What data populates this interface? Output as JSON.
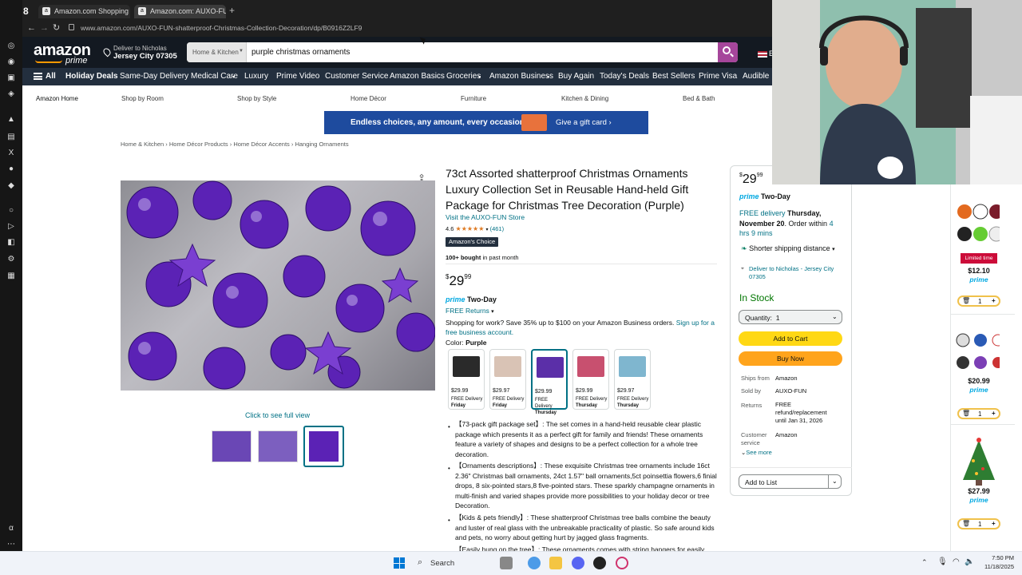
{
  "browser": {
    "tabs": [
      {
        "label": "Amazon.com Shopping C",
        "active": false
      },
      {
        "label": "Amazon.com: AUXO-FUN",
        "active": true
      }
    ],
    "new_tab": "+",
    "url": "www.amazon.com/AUXO-FUN-shatterproof-Christmas-Collection-Decoration/dp/B0916Z2LF9",
    "badge": "8"
  },
  "header": {
    "logo": "amazon",
    "logo_sub": "prime",
    "deliver_line1": "Deliver to Nicholas",
    "deliver_line2": "Jersey City 07305",
    "search_scope": "Home & Kitchen",
    "search_value": "purple christmas ornaments",
    "flag": "E"
  },
  "nav": {
    "all": "All",
    "items": [
      "Holiday Deals",
      "Same-Day Delivery",
      "Medical Care",
      "Luxury",
      "Prime Video",
      "Customer Service",
      "Amazon Basics",
      "Groceries",
      "Amazon Business",
      "Buy Again",
      "Today's Deals",
      "Best Sellers",
      "Prime Visa",
      "Audible"
    ]
  },
  "categories": [
    "Amazon Home",
    "Shop by Room",
    "Shop by Style",
    "Home Décor",
    "Furniture",
    "Kitchen & Dining",
    "Bed & Bath"
  ],
  "banner": {
    "text": "Endless choices, any amount, every occasion",
    "cta": "Give a gift card ›"
  },
  "breadcrumb": [
    "Home & Kitchen",
    "Home Décor Products",
    "Home Décor Accents",
    "Hanging Ornaments"
  ],
  "product": {
    "title": "73ct Assorted shatterproof Christmas Ornaments Luxury Collection Set in Reusable Hand-held Gift Package for Christmas Tree Decoration (Purple)",
    "store": "Visit the AUXO-FUN Store",
    "rating": "4.6",
    "stars": "★★★★★",
    "reviews": "(461)",
    "choice": "Amazon's Choice",
    "bought_bold": "100+ bought",
    "bought_rest": " in past month",
    "price_symbol": "$",
    "price_whole": "29",
    "price_frac": "99",
    "prime": "prime",
    "prime_two_day": "Two-Day",
    "free_returns": "FREE Returns",
    "business_text": "Shopping for work? Save 35% up to $100 on your Amazon Business orders.",
    "business_link": "Sign up for a free business account.",
    "color_label": "Color:",
    "color_value": "Purple",
    "click_full_view": "Click to see full view",
    "swatches": [
      {
        "price": "$29.99",
        "delivery": "FREE Delivery",
        "day": "Friday",
        "color": "#2a2a2a"
      },
      {
        "price": "$29.97",
        "delivery": "FREE Delivery",
        "day": "Friday",
        "color": "#d9c3b5"
      },
      {
        "price": "$29.99",
        "delivery": "FREE Delivery",
        "day": "Thursday",
        "color": "#5b2fa8"
      },
      {
        "price": "$29.99",
        "delivery": "FREE Delivery",
        "day": "Thursday",
        "color": "#c8506f"
      },
      {
        "price": "$29.97",
        "delivery": "FREE Delivery",
        "day": "Thursday",
        "color": "#7fb6cf"
      }
    ],
    "bullets": [
      "【73-pack gift package set】: The set comes in a hand-held reusable clear plastic package which presents it as a perfect gift for family and friends! These ornaments feature a variety of shapes and designs to be a perfect collection for a whole tree decoration.",
      "【Ornaments descriptions】: These exquisite Christmas tree ornaments include 16ct 2.36\" Christmas ball ornaments, 24ct 1.57\" ball ornaments,5ct poinsettia flowers,6 finial drops, 8 six-pointed stars,8 five-pointed stars. These sparkly champagne ornaments in multi-finish and varied shapes provide more possibilities to your holiday decor or tree Decoration.",
      "【Kids & pets friendly】: These shatterproof Christmas tree balls combine the beauty and luster of real glass with the unbreakable practicality of plastic. So safe around kids and pets, no worry about getting hurt by jagged glass fragments.",
      "【Easily hung on the tree】: These ornaments comes with string hangers for easily"
    ]
  },
  "buybox": {
    "price_symbol": "$",
    "price_whole": "29",
    "price_frac": "99",
    "prime": "prime",
    "two_day": "Two-Day",
    "free_delivery": "FREE delivery",
    "delivery_date": "Thursday, November 20",
    "order_within": ". Order within",
    "order_time": "4 hrs 9 mins",
    "shorter_shipping": "Shorter shipping distance",
    "deliver_to": "Deliver to Nicholas - Jersey City 07305",
    "in_stock": "In Stock",
    "quantity": "Quantity:  1",
    "add_to_cart": "Add to Cart",
    "buy_now": "Buy Now",
    "ships_from_label": "Ships from",
    "ships_from": "Amazon",
    "sold_by_label": "Sold by",
    "sold_by": "AUXO-FUN",
    "returns_label": "Returns",
    "returns": "FREE refund/replacement until Jan 31, 2026",
    "cs_label": "Customer service",
    "cs": "Amazon",
    "see_more": "See more",
    "add_to_list": "Add to List"
  },
  "rail": [
    {
      "badge": "Limited time",
      "price": "$12.10",
      "prime": "prime",
      "qty": "1"
    },
    {
      "price": "$20.99",
      "prime": "prime",
      "qty": "1"
    },
    {
      "price": "$27.99",
      "prime": "prime",
      "qty": "1"
    }
  ],
  "taskbar": {
    "search": "Search",
    "time": "7:50 PM",
    "date": "11/18/2025"
  },
  "colors": {
    "amazon_dark": "#131921",
    "amazon_nav": "#232f3e",
    "search_btn": "#a6469b",
    "cart_yellow": "#ffd814",
    "buy_orange": "#ffa41c",
    "link": "#007185",
    "in_stock": "#007600"
  }
}
